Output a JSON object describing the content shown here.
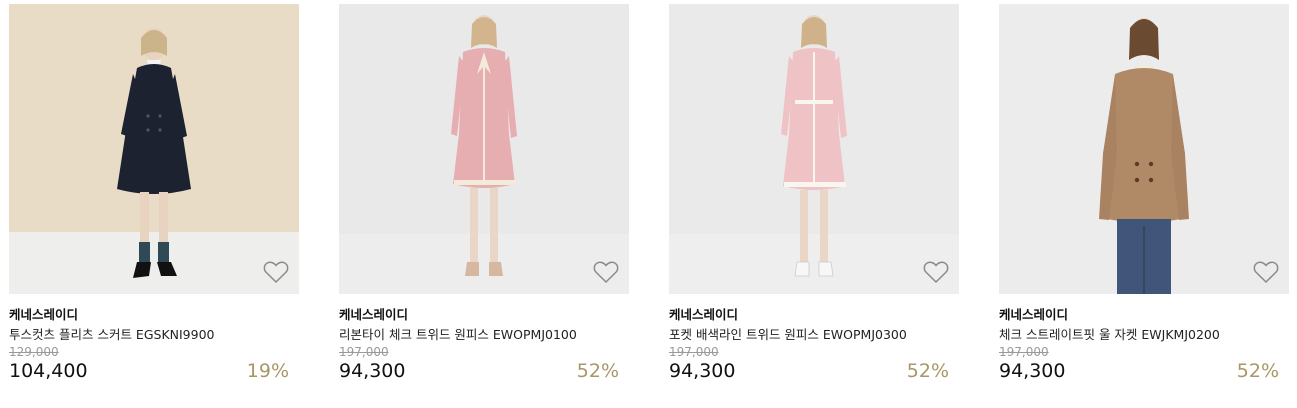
{
  "colors": {
    "discount": "#a89766",
    "original_price": "#9a9a9a"
  },
  "products": [
    {
      "brand": "케네스레이디",
      "name": "투스컷츠 플리츠 스커트 EGSKNI9900",
      "original_price": "129,000",
      "price": "104,400",
      "discount": "19%",
      "wishlist_icon": "heart-outline-icon"
    },
    {
      "brand": "케네스레이디",
      "name": "리본타이 체크 트위드 원피스 EWOPMJ0100",
      "original_price": "197,000",
      "price": "94,300",
      "discount": "52%",
      "wishlist_icon": "heart-outline-icon"
    },
    {
      "brand": "케네스레이디",
      "name": "포켓 배색라인 트위드 원피스 EWOPMJ0300",
      "original_price": "197,000",
      "price": "94,300",
      "discount": "52%",
      "wishlist_icon": "heart-outline-icon"
    },
    {
      "brand": "케네스레이디",
      "name": "체크 스트레이트핏 울 자켓 EWJKMJ0200",
      "original_price": "197,000",
      "price": "94,300",
      "discount": "52%",
      "wishlist_icon": "heart-outline-icon"
    }
  ]
}
